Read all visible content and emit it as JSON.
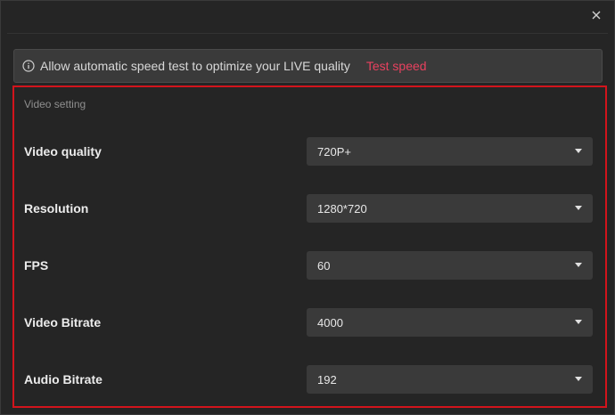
{
  "banner": {
    "icon": "info-icon",
    "message": "Allow automatic speed test to optimize your LIVE quality",
    "link": "Test speed",
    "link_color": "#e8415f"
  },
  "panel": {
    "highlight_color": "#d2141c",
    "section_title": "Video setting",
    "rows": [
      {
        "label": "Video quality",
        "value": "720P+"
      },
      {
        "label": "Resolution",
        "value": "1280*720"
      },
      {
        "label": "FPS",
        "value": "60"
      },
      {
        "label": "Video Bitrate",
        "value": "4000"
      },
      {
        "label": "Audio Bitrate",
        "value": "192"
      }
    ]
  }
}
